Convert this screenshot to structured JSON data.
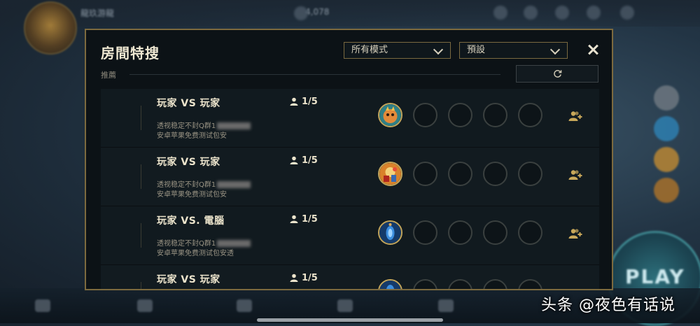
{
  "background": {
    "player_name": "龍玖游龍",
    "currency": "4,078"
  },
  "modal": {
    "title": "房間特搜",
    "mode_filter": "所有模式",
    "preset_filter": "預設",
    "section_label": "推薦"
  },
  "rooms": [
    {
      "name": "玩家 VS 玩家",
      "count": "1/5",
      "desc_line1": "透视稳定不封Q群1",
      "desc_line2": "安卓苹果免费测试包安",
      "host_avatar": "orange-champion-portrait",
      "filled_slots": 1,
      "total_slots": 5
    },
    {
      "name": "玩家 VS 玩家",
      "count": "1/5",
      "desc_line1": "透视稳定不封Q群1",
      "desc_line2": "安卓苹果免费测试包安",
      "host_avatar": "fire-champion-portrait",
      "filled_slots": 1,
      "total_slots": 5
    },
    {
      "name": "玩家 VS. 電腦",
      "count": "1/5",
      "desc_line1": "透视稳定不封Q群1",
      "desc_line2": "安卓苹果免费测试包安透",
      "host_avatar": "blue-champion-portrait",
      "filled_slots": 1,
      "total_slots": 5
    },
    {
      "name": "玩家 VS 玩家",
      "count": "1/5",
      "desc_line1": "",
      "desc_line2": "",
      "host_avatar": "blue-champion-portrait",
      "filled_slots": 1,
      "total_slots": 5
    }
  ],
  "play_button": "PLAY",
  "watermark": "头条 @夜色有话说",
  "colors": {
    "gold_border": "#7d6a3e",
    "panel_bg": "#0c1216",
    "text_primary": "#ece4cc"
  }
}
